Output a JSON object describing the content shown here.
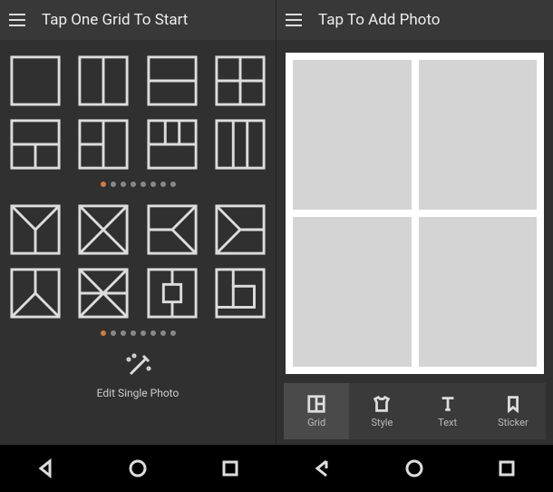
{
  "left": {
    "title": "Tap One Grid To Start",
    "dots": {
      "count": 8,
      "active": 0
    },
    "magic_label": "Edit Single Photo",
    "grids_page1": [
      "single",
      "v-split",
      "h-split",
      "quad",
      "t-top",
      "t-left",
      "t-grid",
      "cols3"
    ],
    "grids_page2": [
      "tri-up",
      "tri-x",
      "tri-right",
      "tri-left",
      "tri-down",
      "envelope",
      "frame-center",
      "frame-corner"
    ]
  },
  "right": {
    "title": "Tap To Add Photo",
    "canvas_layout": "quad",
    "toolbar": [
      {
        "id": "grid",
        "label": "Grid",
        "icon": "grid-icon"
      },
      {
        "id": "style",
        "label": "Style",
        "icon": "shirt-icon"
      },
      {
        "id": "text",
        "label": "Text",
        "icon": "text-icon"
      },
      {
        "id": "sticker",
        "label": "Sticker",
        "icon": "bookmark-icon"
      }
    ]
  },
  "nav": {
    "back": "back-icon",
    "home": "home-icon",
    "recent": "recent-icon"
  }
}
